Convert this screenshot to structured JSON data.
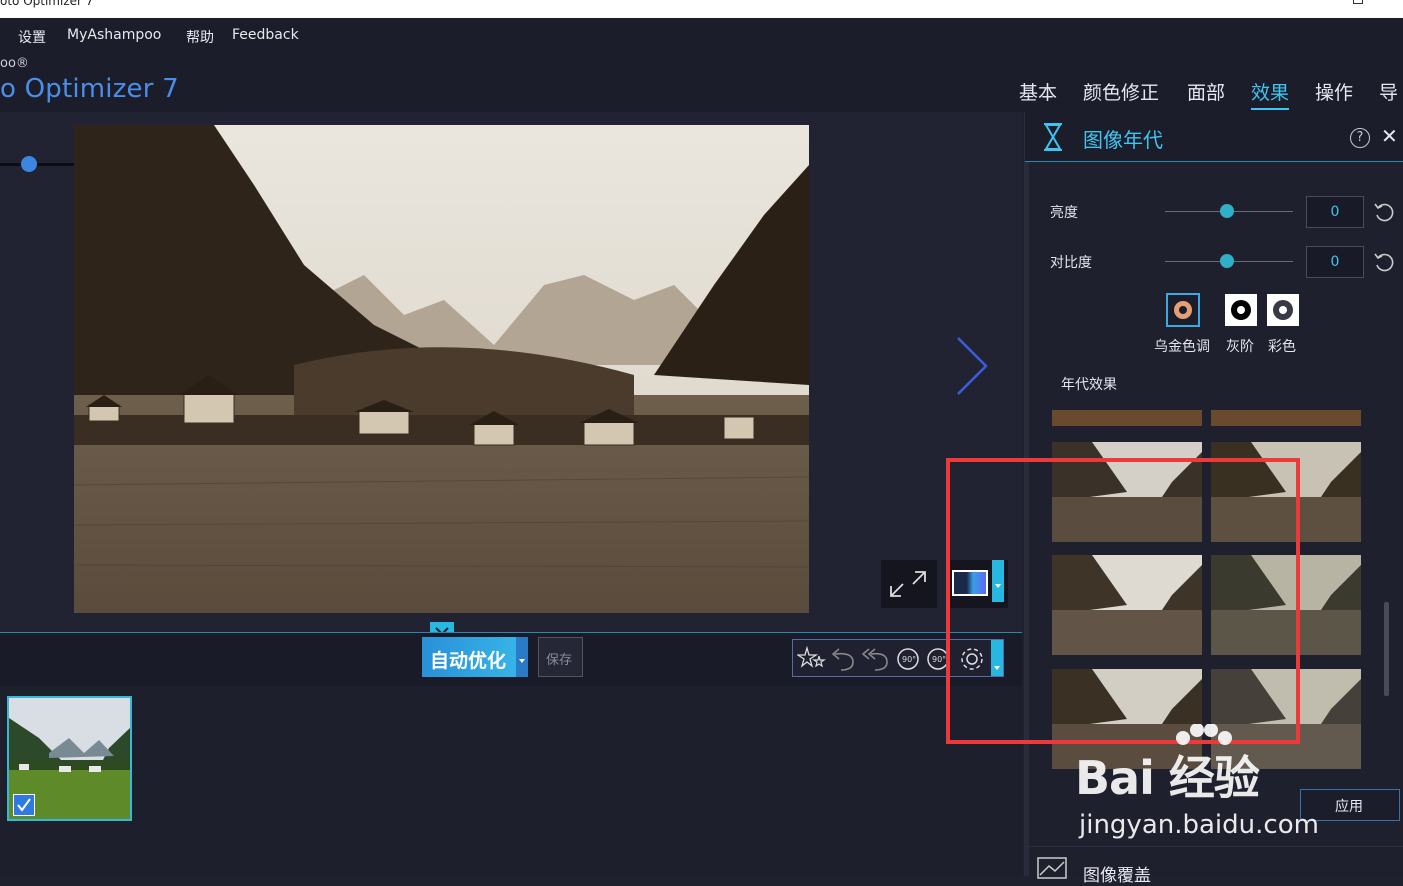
{
  "window": {
    "title": "oto Optimizer 7"
  },
  "menu": {
    "settings": "设置",
    "myashampoo": "MyAshampoo",
    "help": "帮助",
    "feedback": "Feedback"
  },
  "brand": {
    "small": "oo®",
    "name": "o Optimizer 7"
  },
  "tabs": [
    {
      "label": "基本"
    },
    {
      "label": "颜色修正"
    },
    {
      "label": "面部"
    },
    {
      "label": "效果"
    },
    {
      "label": "操作"
    },
    {
      "label": "导"
    }
  ],
  "active_tab": "效果",
  "zoom": {
    "plus": "+"
  },
  "toolbar": {
    "auto_optimize": "自动优化",
    "save": "保存"
  },
  "panel": {
    "title": "图像年代",
    "help": "?",
    "close": "✕",
    "brightness": {
      "label": "亮度",
      "value": "0"
    },
    "contrast": {
      "label": "对比度",
      "value": "0"
    },
    "tones": [
      {
        "label": "乌金色调"
      },
      {
        "label": "灰阶"
      },
      {
        "label": "彩色"
      }
    ],
    "section_label": "年代效果",
    "apply": "应用",
    "next_section": "图像覆盖"
  },
  "watermark": {
    "big": "Bai 经验",
    "small": "jingyan.baidu.com"
  },
  "colors": {
    "accent": "#3fc4f0",
    "highlight": "#ec3a3a",
    "bg": "#20212f"
  }
}
